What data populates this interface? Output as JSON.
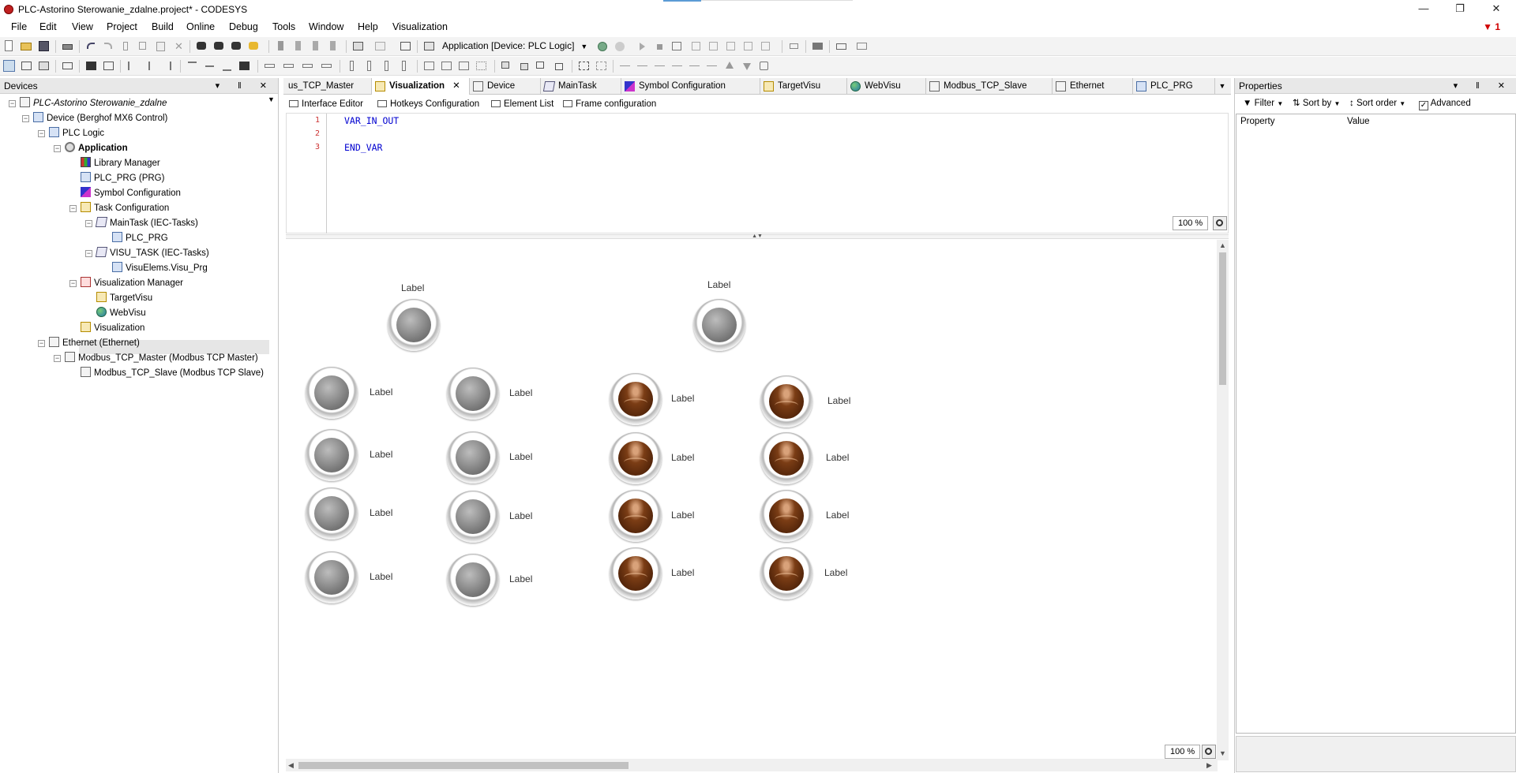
{
  "window": {
    "title": "PLC-Astorino Sterowanie_zdalne.project* - CODESYS",
    "minimize": "—",
    "restore": "❐",
    "close": "✕"
  },
  "menu": [
    "File",
    "Edit",
    "View",
    "Project",
    "Build",
    "Online",
    "Debug",
    "Tools",
    "Window",
    "Help",
    "Visualization"
  ],
  "notification_count": "1",
  "toolbar": {
    "application_selector": "Application [Device: PLC Logic]"
  },
  "devices_panel": {
    "title": "Devices",
    "header_buttons": "▾ ‖ ✕",
    "tree": [
      {
        "label": "PLC-Astorino Sterowanie_zdalne",
        "toggle": "−"
      },
      {
        "label": "Device (Berghof MX6 Control)",
        "toggle": "−"
      },
      {
        "label": "PLC Logic",
        "toggle": "−"
      },
      {
        "label": "Application",
        "toggle": "−"
      },
      {
        "label": "Library Manager"
      },
      {
        "label": "PLC_PRG (PRG)"
      },
      {
        "label": "Symbol Configuration"
      },
      {
        "label": "Task Configuration",
        "toggle": "−"
      },
      {
        "label": "MainTask (IEC-Tasks)",
        "toggle": "−"
      },
      {
        "label": "PLC_PRG"
      },
      {
        "label": "VISU_TASK (IEC-Tasks)",
        "toggle": "−"
      },
      {
        "label": "VisuElems.Visu_Prg"
      },
      {
        "label": "Visualization Manager",
        "toggle": "−"
      },
      {
        "label": "TargetVisu"
      },
      {
        "label": "WebVisu"
      },
      {
        "label": "Visualization"
      },
      {
        "label": "Ethernet (Ethernet)",
        "toggle": "−"
      },
      {
        "label": "Modbus_TCP_Master (Modbus TCP Master)",
        "toggle": "−"
      },
      {
        "label": "Modbus_TCP_Slave (Modbus TCP Slave)"
      }
    ]
  },
  "editor_tabs": [
    {
      "label": "us_TCP_Master"
    },
    {
      "label": "Visualization",
      "active": true,
      "close": "✕"
    },
    {
      "label": "Device"
    },
    {
      "label": "MainTask"
    },
    {
      "label": "Symbol Configuration"
    },
    {
      "label": "TargetVisu"
    },
    {
      "label": "WebVisu"
    },
    {
      "label": "Modbus_TCP_Slave"
    },
    {
      "label": "Ethernet"
    },
    {
      "label": "PLC_PRG"
    }
  ],
  "tabs_dropdown": "▼",
  "sub_tabs": [
    "Interface Editor",
    "Hotkeys Configuration",
    "Element List",
    "Frame configuration"
  ],
  "declaration": {
    "lines": [
      {
        "no": "1",
        "code": "VAR_IN_OUT"
      },
      {
        "no": "2",
        "code": ""
      },
      {
        "no": "3",
        "code": "END_VAR"
      }
    ],
    "zoom": "100 %"
  },
  "splitter_arrows": "▲▼",
  "visualization": {
    "zoom": "100 %",
    "label_text": "Label",
    "lamps": [
      {
        "color": "gray"
      },
      {
        "color": "gray"
      },
      {
        "color": "gray"
      },
      {
        "color": "gray"
      },
      {
        "color": "brown"
      },
      {
        "color": "brown"
      },
      {
        "color": "gray"
      },
      {
        "color": "gray"
      },
      {
        "color": "brown"
      },
      {
        "color": "brown"
      },
      {
        "color": "gray"
      },
      {
        "color": "gray"
      },
      {
        "color": "brown"
      },
      {
        "color": "brown"
      },
      {
        "color": "gray"
      },
      {
        "color": "gray"
      },
      {
        "color": "brown"
      },
      {
        "color": "brown"
      }
    ],
    "scroll_arrows": {
      "up": "▲",
      "down": "▼",
      "left": "◀",
      "right": "▶"
    }
  },
  "properties_panel": {
    "title": "Properties",
    "header_buttons": "▾ ‖ ✕",
    "filter": "Filter",
    "sort_by": "Sort by",
    "sort_order": "Sort order",
    "advanced": "Advanced",
    "advanced_checked": true,
    "columns": [
      "Property",
      "Value"
    ]
  },
  "colors": {
    "accent": "#5b9bd5",
    "code_keyword": "#0000d0",
    "line_number": "#cc3333",
    "notification": "#d00000"
  }
}
